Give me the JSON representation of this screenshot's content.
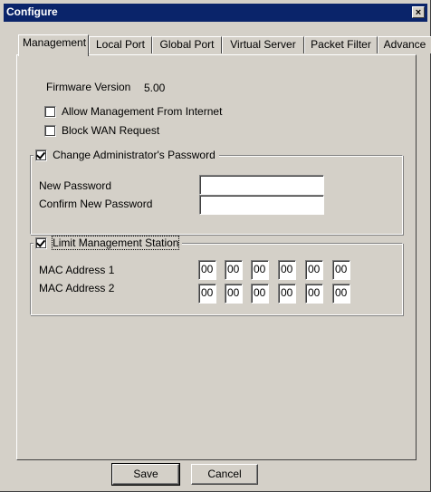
{
  "window": {
    "title": "Configure",
    "close_glyph": "✕"
  },
  "tabs": [
    {
      "label": "Management",
      "active": true
    },
    {
      "label": "Local Port"
    },
    {
      "label": "Global Port"
    },
    {
      "label": "Virtual Server"
    },
    {
      "label": "Packet Filter"
    },
    {
      "label": "Advance"
    }
  ],
  "management": {
    "firmware_label": "Firmware Version",
    "firmware_value": "5.00",
    "allow_mgmt_label": "Allow Management From Internet",
    "allow_mgmt_checked": false,
    "block_wan_label": "Block WAN Request",
    "block_wan_checked": false,
    "change_password": {
      "label": "Change Administrator's Password",
      "checked": true,
      "new_password_label": "New Password",
      "new_password_value": "",
      "confirm_password_label": "Confirm New Password",
      "confirm_password_value": ""
    },
    "limit_station": {
      "label": "Limit Management Station",
      "checked": true,
      "mac1_label": "MAC Address 1",
      "mac1": [
        "00",
        "00",
        "00",
        "00",
        "00",
        "00"
      ],
      "mac2_label": "MAC Address 2",
      "mac2": [
        "00",
        "00",
        "00",
        "00",
        "00",
        "00"
      ]
    }
  },
  "buttons": {
    "save": "Save",
    "cancel": "Cancel"
  }
}
